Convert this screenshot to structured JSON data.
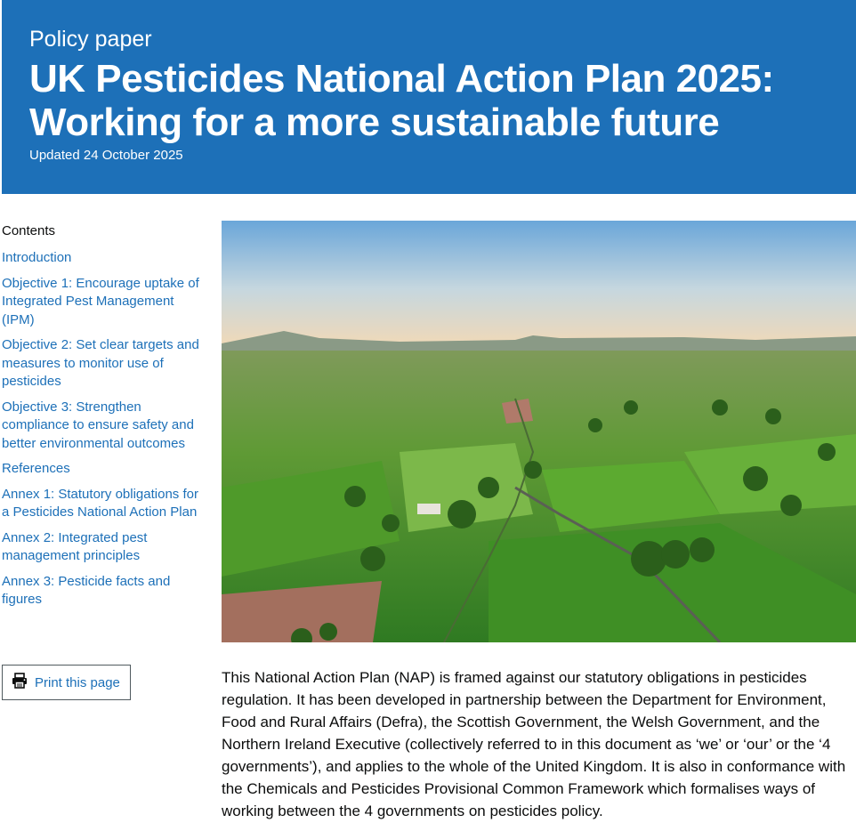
{
  "header": {
    "doc_type": "Policy paper",
    "title": "UK Pesticides National Action Plan 2025: Working for a more sustainable future",
    "updated": "Updated 24 October 2025"
  },
  "contents": {
    "heading": "Contents",
    "items": [
      {
        "label": "Introduction"
      },
      {
        "label": "Objective 1: Encourage uptake of Integrated Pest Management (IPM)"
      },
      {
        "label": "Objective 2: Set clear targets and measures to monitor use of pesticides"
      },
      {
        "label": "Objective 3: Strengthen compliance to ensure safety and better environmental outcomes"
      },
      {
        "label": "References"
      },
      {
        "label": "Annex 1: Statutory obligations for a Pesticides National Action Plan"
      },
      {
        "label": "Annex 2: Integrated pest management principles"
      },
      {
        "label": "Annex 3: Pesticide facts and figures"
      }
    ]
  },
  "print": {
    "label": "Print this page",
    "icon": "printer-icon"
  },
  "hero": {
    "icon": "landscape-image"
  },
  "body": {
    "intro": "This National Action Plan (NAP) is framed against our statutory obligations in pesticides regulation. It has been developed in partnership between the Department for Environment, Food and Rural Affairs (Defra), the Scottish Government, the Welsh Government, and the Northern Ireland Executive (collectively referred to in this document as ‘we’ or ‘our’ or the ‘4 governments’), and applies to the whole of the United Kingdom. It is also in conformance with the Chemicals and Pesticides Provisional Common Framework which formalises ways of working between the 4 governments on pesticides policy."
  },
  "colors": {
    "brand": "#1d70b8",
    "text": "#0b0c0c",
    "link": "#1d70b8"
  }
}
